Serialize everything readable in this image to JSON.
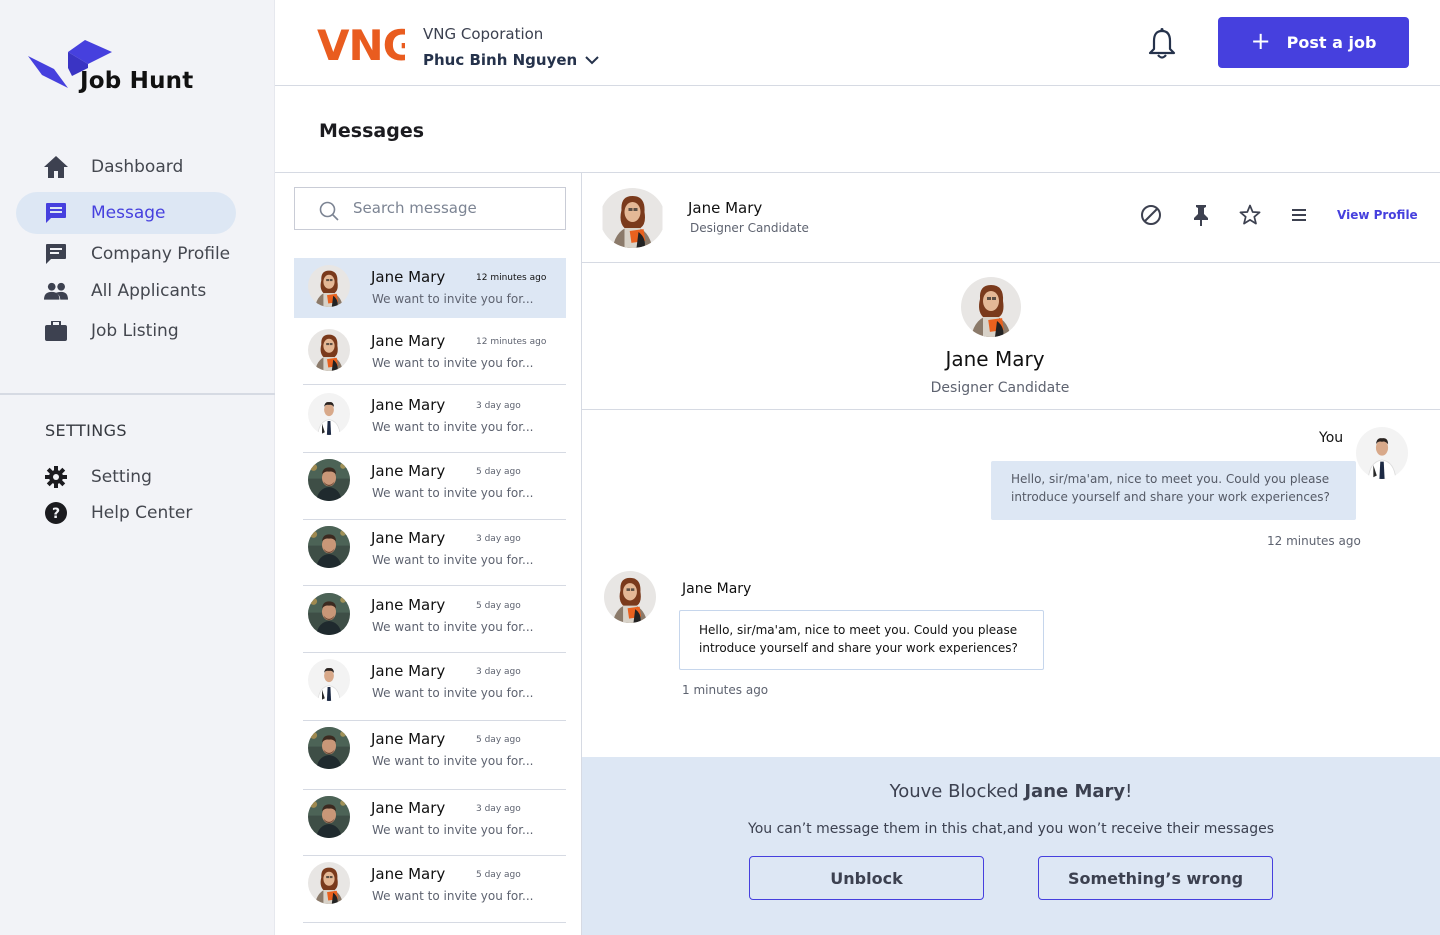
{
  "brand": {
    "name": "Job Hunt",
    "logo_color": "#4640de"
  },
  "sidebar": {
    "items": [
      {
        "label": "Dashboard",
        "icon": "home-icon"
      },
      {
        "label": "Message",
        "icon": "message-icon",
        "active": true
      },
      {
        "label": "Company Profile",
        "icon": "chat-icon"
      },
      {
        "label": "All Applicants",
        "icon": "people-icon"
      },
      {
        "label": "Job Listing",
        "icon": "briefcase-icon"
      }
    ],
    "settings_title": "SETTINGS",
    "settings_items": [
      {
        "label": "Setting",
        "icon": "gear-icon"
      },
      {
        "label": "Help Center",
        "icon": "help-icon"
      }
    ]
  },
  "header": {
    "company_logo": "VNG",
    "company_label": "VNG Coporation",
    "user_name": "Phuc Binh Nguyen",
    "post_button": "Post a job",
    "accent": "#4640de",
    "logo_color": "#e95c1f"
  },
  "page": {
    "title": "Messages"
  },
  "search": {
    "placeholder": "Search message"
  },
  "conversations": [
    {
      "name": "Jane Mary",
      "time": "12 minutes ago",
      "preview": "We want to invite you for...",
      "avatar": "woman"
    },
    {
      "name": "Jane Mary",
      "time": "12 minutes ago",
      "preview": "We want to invite you for...",
      "avatar": "woman"
    },
    {
      "name": "Jane Mary",
      "time": "3 day ago",
      "preview": "We want to invite you for...",
      "avatar": "man-suit"
    },
    {
      "name": "Jane Mary",
      "time": "5 day ago",
      "preview": "We want to invite you for...",
      "avatar": "man-dark"
    },
    {
      "name": "Jane Mary",
      "time": "3 day ago",
      "preview": "We want to invite you for...",
      "avatar": "man-dark"
    },
    {
      "name": "Jane Mary",
      "time": "5 day ago",
      "preview": "We want to invite you for...",
      "avatar": "man-dark"
    },
    {
      "name": "Jane Mary",
      "time": "3 day ago",
      "preview": "We want to invite you for...",
      "avatar": "man-suit"
    },
    {
      "name": "Jane Mary",
      "time": "5 day ago",
      "preview": "We want to invite you for...",
      "avatar": "man-dark"
    },
    {
      "name": "Jane Mary",
      "time": "3 day ago",
      "preview": "We want to invite you for...",
      "avatar": "man-dark"
    },
    {
      "name": "Jane Mary",
      "time": "5 day ago",
      "preview": "We want to invite you for...",
      "avatar": "woman"
    }
  ],
  "chat": {
    "name": "Jane Mary",
    "role": "Designer Candidate",
    "view_profile": "View Profile",
    "actions": [
      "block-icon",
      "pin-icon",
      "star-icon",
      "menu-icon"
    ],
    "profile_name": "Jane Mary",
    "profile_role": "Designer Candidate",
    "outgoing": {
      "sender": "You",
      "text": "Hello, sir/ma'am, nice to meet you. Could you please introduce yourself and share your work experiences?",
      "time": "12 minutes ago"
    },
    "incoming": {
      "sender": "Jane Mary",
      "text": "Hello, sir/ma'am, nice to meet you. Could you please introduce yourself and share your work experiences?",
      "time": "1 minutes ago"
    }
  },
  "blocked": {
    "prefix": "Youve Blocked ",
    "name": "Jane Mary",
    "suffix": "!",
    "description": "You can’t message them in this chat,and you won’t receive their messages",
    "unblock": "Unblock",
    "report": "Something’s wrong"
  }
}
